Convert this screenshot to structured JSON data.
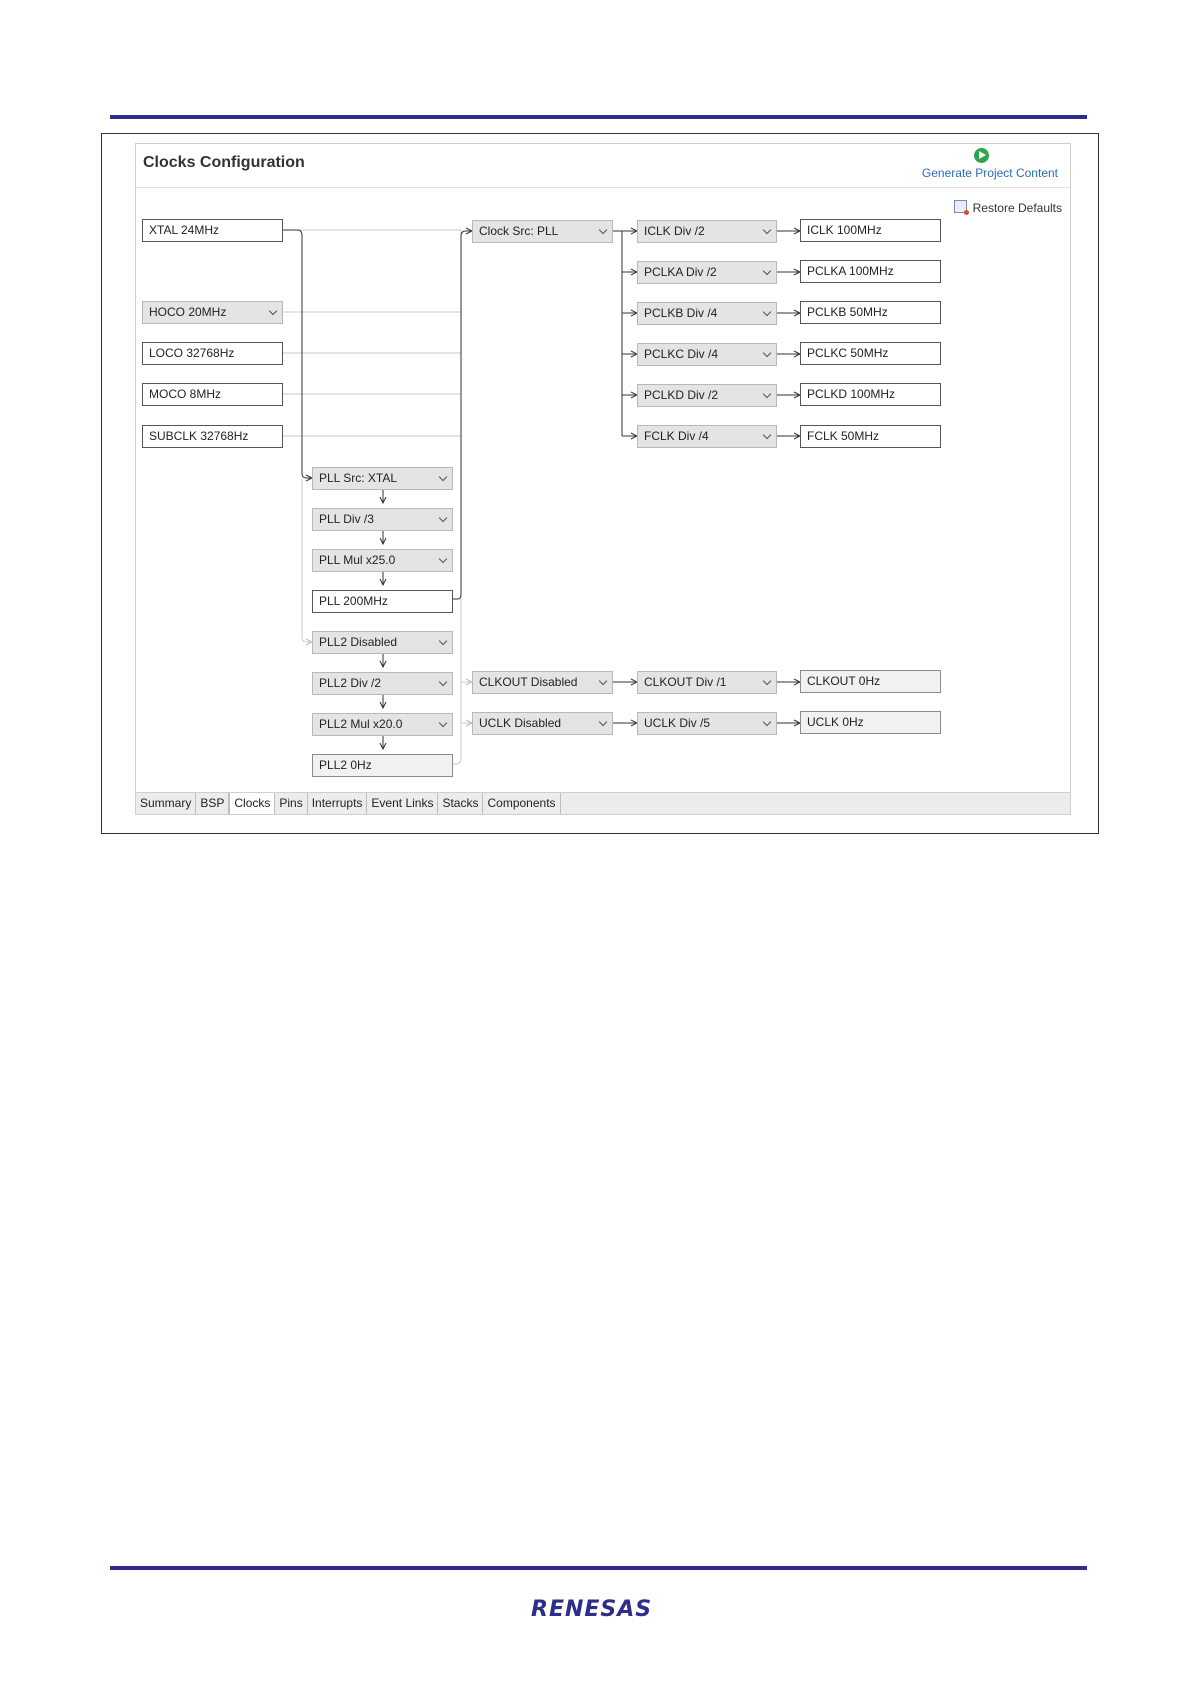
{
  "window": {
    "title": "Clocks Configuration"
  },
  "header": {
    "generate_label": "Generate Project Content",
    "restore_label": "Restore Defaults"
  },
  "sources": {
    "xtal": "XTAL 24MHz",
    "hoco": "HOCO 20MHz",
    "loco": "LOCO 32768Hz",
    "moco": "MOCO 8MHz",
    "subclk": "SUBCLK 32768Hz"
  },
  "pll": {
    "src": "PLL Src: XTAL",
    "div": "PLL Div /3",
    "mul": "PLL Mul x25.0",
    "out": "PLL 200MHz"
  },
  "pll2": {
    "src": "PLL2 Disabled",
    "div": "PLL2 Div /2",
    "mul": "PLL2 Mul x20.0",
    "out": "PLL2 0Hz"
  },
  "clock_src": "Clock Src: PLL",
  "dividers": {
    "iclk": "ICLK Div /2",
    "pclka": "PCLKA Div /2",
    "pclkb": "PCLKB Div /4",
    "pclkc": "PCLKC Div /4",
    "pclkd": "PCLKD Div /2",
    "fclk": "FCLK Div /4"
  },
  "outputs": {
    "iclk": "ICLK 100MHz",
    "pclka": "PCLKA 100MHz",
    "pclkb": "PCLKB 50MHz",
    "pclkc": "PCLKC 50MHz",
    "pclkd": "PCLKD 100MHz",
    "fclk": "FCLK 50MHz"
  },
  "clkout": {
    "src": "CLKOUT Disabled",
    "div": "CLKOUT Div /1",
    "out": "CLKOUT 0Hz"
  },
  "uclk": {
    "src": "UCLK Disabled",
    "div": "UCLK Div /5",
    "out": "UCLK 0Hz"
  },
  "tabs": [
    "Summary",
    "BSP",
    "Clocks",
    "Pins",
    "Interrupts",
    "Event Links",
    "Stacks",
    "Components"
  ],
  "active_tab": "Clocks",
  "logo": {
    "text": "RENESAS",
    "color": "#2e2d8c"
  },
  "colors": {
    "rule": "#2e2d8c",
    "link": "#2a6ebb",
    "run_icon": "#2ea44f"
  }
}
